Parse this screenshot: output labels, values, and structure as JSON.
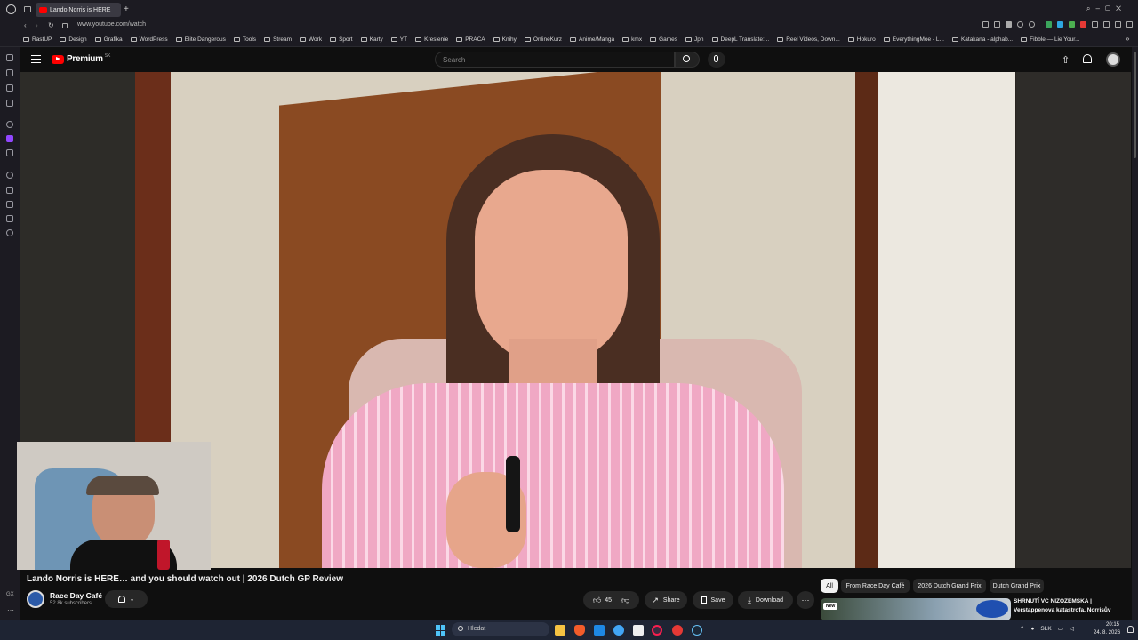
{
  "browser": {
    "tab_title": "Lando Norris is HERE",
    "url": "www.youtube.com/watch",
    "bookmarks": [
      "RastUP",
      "Design",
      "Grafika",
      "WordPress",
      "Elite Dangerous",
      "Tools",
      "Stream",
      "Work",
      "Sport",
      "Karty",
      "YT",
      "Kreslenie",
      "PRACA",
      "Knihy",
      "OnlineKurz",
      "Anime/Manga",
      "kmx",
      "Games",
      "Jpn",
      "DeepL Translate:...",
      "Reel Videos, Down...",
      "Hokuro",
      "EverythingMoe - L...",
      "Katakana - alphab...",
      "Fibble — Lie Your..."
    ]
  },
  "youtube": {
    "logo_text": "Premium",
    "logo_region": "SK",
    "search_placeholder": "Search"
  },
  "video": {
    "title": "Lando Norris is HERE… and you should watch out | 2026 Dutch GP Review",
    "channel_name": "Race Day Café",
    "subscribers": "52.8k subscribers",
    "likes": "45",
    "share_label": "Share",
    "save_label": "Save",
    "download_label": "Download"
  },
  "filters": [
    "All",
    "From Race Day Café",
    "2026 Dutch Grand Prix",
    "Dutch Grand Prix"
  ],
  "recommended": {
    "badge": "New",
    "title_line1": "SHRNUTÍ VC NIZOZEMSKA |",
    "title_line2": "Verstappenova katastrofa, Norrisův"
  },
  "taskbar": {
    "search_placeholder": "Hledat",
    "language": "SLK",
    "time": "20:15",
    "date": "24. 8. 2026"
  },
  "colors": {
    "yt_red": "#ff0000",
    "background": "#0f0f0f",
    "pill": "#272727",
    "taskbar": "#1e2433"
  }
}
